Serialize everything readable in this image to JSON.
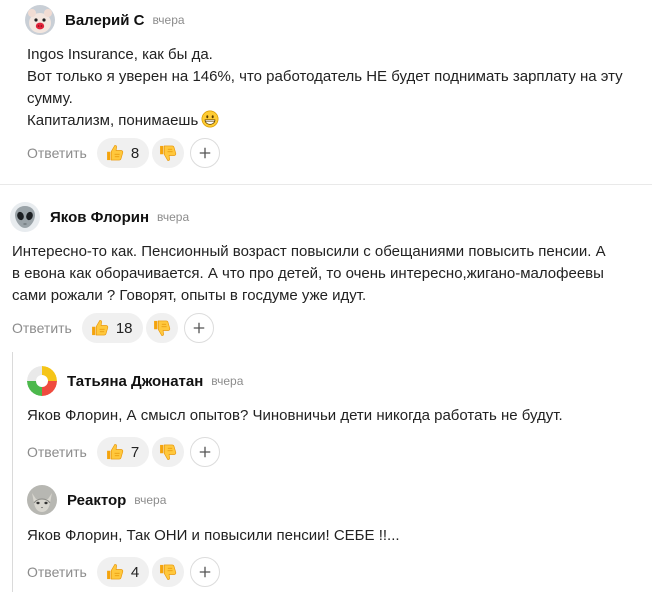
{
  "comments": [
    {
      "author": "Валерий С",
      "time": "вчера",
      "avatar_icon": "pig-avatar-icon",
      "lines": [
        "Ingos Insurance, как бы да.",
        "Вот только я уверен на 146%, что работодатель НЕ будет поднимать зарплату на эту",
        "сумму.",
        "Капитализм, понимаешь"
      ],
      "reply_label": "Ответить",
      "likes": "8"
    },
    {
      "author": "Яков Флорин",
      "time": "вчера",
      "avatar_icon": "alien-avatar-icon",
      "lines": [
        "Интересно-то как. Пенсионный возраст повысили с обещаниями повысить пенсии. А",
        "в евона как оборачивается. А что про детей, то очень интересно,жигано-малофеевы",
        "сами рожали ? Говорят, опыты в госдуме уже идут."
      ],
      "reply_label": "Ответить",
      "likes": "18"
    },
    {
      "author": "Татьяна Джонатан",
      "time": "вчера",
      "avatar_icon": "colorful-avatar-icon",
      "lines": [
        "Яков Флорин, А смысл опытов? Чиновничьи дети никогда работать не будут."
      ],
      "reply_label": "Ответить",
      "likes": "7"
    },
    {
      "author": "Реактор",
      "time": "вчера",
      "avatar_icon": "cat-avatar-icon",
      "lines": [
        "Яков Флорин, Так ОНИ и повысили пенсии! СЕБЕ !!..."
      ],
      "reply_label": "Ответить",
      "likes": "4"
    }
  ]
}
